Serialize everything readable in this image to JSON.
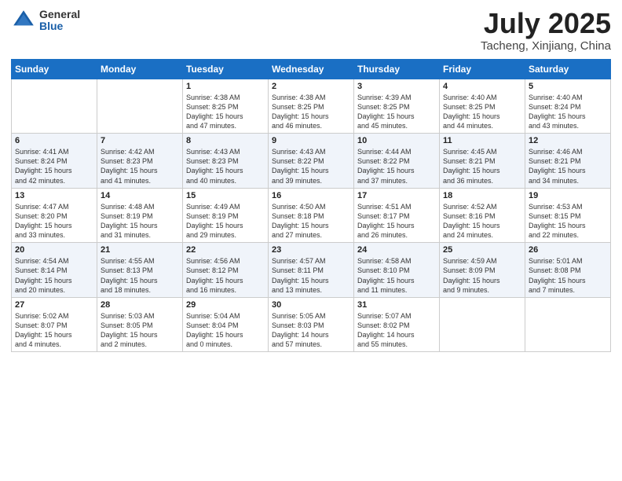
{
  "header": {
    "logo_general": "General",
    "logo_blue": "Blue",
    "month_title": "July 2025",
    "location": "Tacheng, Xinjiang, China"
  },
  "weekdays": [
    "Sunday",
    "Monday",
    "Tuesday",
    "Wednesday",
    "Thursday",
    "Friday",
    "Saturday"
  ],
  "weeks": [
    [
      {
        "day": "",
        "info": ""
      },
      {
        "day": "",
        "info": ""
      },
      {
        "day": "1",
        "info": "Sunrise: 4:38 AM\nSunset: 8:25 PM\nDaylight: 15 hours\nand 47 minutes."
      },
      {
        "day": "2",
        "info": "Sunrise: 4:38 AM\nSunset: 8:25 PM\nDaylight: 15 hours\nand 46 minutes."
      },
      {
        "day": "3",
        "info": "Sunrise: 4:39 AM\nSunset: 8:25 PM\nDaylight: 15 hours\nand 45 minutes."
      },
      {
        "day": "4",
        "info": "Sunrise: 4:40 AM\nSunset: 8:25 PM\nDaylight: 15 hours\nand 44 minutes."
      },
      {
        "day": "5",
        "info": "Sunrise: 4:40 AM\nSunset: 8:24 PM\nDaylight: 15 hours\nand 43 minutes."
      }
    ],
    [
      {
        "day": "6",
        "info": "Sunrise: 4:41 AM\nSunset: 8:24 PM\nDaylight: 15 hours\nand 42 minutes."
      },
      {
        "day": "7",
        "info": "Sunrise: 4:42 AM\nSunset: 8:23 PM\nDaylight: 15 hours\nand 41 minutes."
      },
      {
        "day": "8",
        "info": "Sunrise: 4:43 AM\nSunset: 8:23 PM\nDaylight: 15 hours\nand 40 minutes."
      },
      {
        "day": "9",
        "info": "Sunrise: 4:43 AM\nSunset: 8:22 PM\nDaylight: 15 hours\nand 39 minutes."
      },
      {
        "day": "10",
        "info": "Sunrise: 4:44 AM\nSunset: 8:22 PM\nDaylight: 15 hours\nand 37 minutes."
      },
      {
        "day": "11",
        "info": "Sunrise: 4:45 AM\nSunset: 8:21 PM\nDaylight: 15 hours\nand 36 minutes."
      },
      {
        "day": "12",
        "info": "Sunrise: 4:46 AM\nSunset: 8:21 PM\nDaylight: 15 hours\nand 34 minutes."
      }
    ],
    [
      {
        "day": "13",
        "info": "Sunrise: 4:47 AM\nSunset: 8:20 PM\nDaylight: 15 hours\nand 33 minutes."
      },
      {
        "day": "14",
        "info": "Sunrise: 4:48 AM\nSunset: 8:19 PM\nDaylight: 15 hours\nand 31 minutes."
      },
      {
        "day": "15",
        "info": "Sunrise: 4:49 AM\nSunset: 8:19 PM\nDaylight: 15 hours\nand 29 minutes."
      },
      {
        "day": "16",
        "info": "Sunrise: 4:50 AM\nSunset: 8:18 PM\nDaylight: 15 hours\nand 27 minutes."
      },
      {
        "day": "17",
        "info": "Sunrise: 4:51 AM\nSunset: 8:17 PM\nDaylight: 15 hours\nand 26 minutes."
      },
      {
        "day": "18",
        "info": "Sunrise: 4:52 AM\nSunset: 8:16 PM\nDaylight: 15 hours\nand 24 minutes."
      },
      {
        "day": "19",
        "info": "Sunrise: 4:53 AM\nSunset: 8:15 PM\nDaylight: 15 hours\nand 22 minutes."
      }
    ],
    [
      {
        "day": "20",
        "info": "Sunrise: 4:54 AM\nSunset: 8:14 PM\nDaylight: 15 hours\nand 20 minutes."
      },
      {
        "day": "21",
        "info": "Sunrise: 4:55 AM\nSunset: 8:13 PM\nDaylight: 15 hours\nand 18 minutes."
      },
      {
        "day": "22",
        "info": "Sunrise: 4:56 AM\nSunset: 8:12 PM\nDaylight: 15 hours\nand 16 minutes."
      },
      {
        "day": "23",
        "info": "Sunrise: 4:57 AM\nSunset: 8:11 PM\nDaylight: 15 hours\nand 13 minutes."
      },
      {
        "day": "24",
        "info": "Sunrise: 4:58 AM\nSunset: 8:10 PM\nDaylight: 15 hours\nand 11 minutes."
      },
      {
        "day": "25",
        "info": "Sunrise: 4:59 AM\nSunset: 8:09 PM\nDaylight: 15 hours\nand 9 minutes."
      },
      {
        "day": "26",
        "info": "Sunrise: 5:01 AM\nSunset: 8:08 PM\nDaylight: 15 hours\nand 7 minutes."
      }
    ],
    [
      {
        "day": "27",
        "info": "Sunrise: 5:02 AM\nSunset: 8:07 PM\nDaylight: 15 hours\nand 4 minutes."
      },
      {
        "day": "28",
        "info": "Sunrise: 5:03 AM\nSunset: 8:05 PM\nDaylight: 15 hours\nand 2 minutes."
      },
      {
        "day": "29",
        "info": "Sunrise: 5:04 AM\nSunset: 8:04 PM\nDaylight: 15 hours\nand 0 minutes."
      },
      {
        "day": "30",
        "info": "Sunrise: 5:05 AM\nSunset: 8:03 PM\nDaylight: 14 hours\nand 57 minutes."
      },
      {
        "day": "31",
        "info": "Sunrise: 5:07 AM\nSunset: 8:02 PM\nDaylight: 14 hours\nand 55 minutes."
      },
      {
        "day": "",
        "info": ""
      },
      {
        "day": "",
        "info": ""
      }
    ]
  ]
}
